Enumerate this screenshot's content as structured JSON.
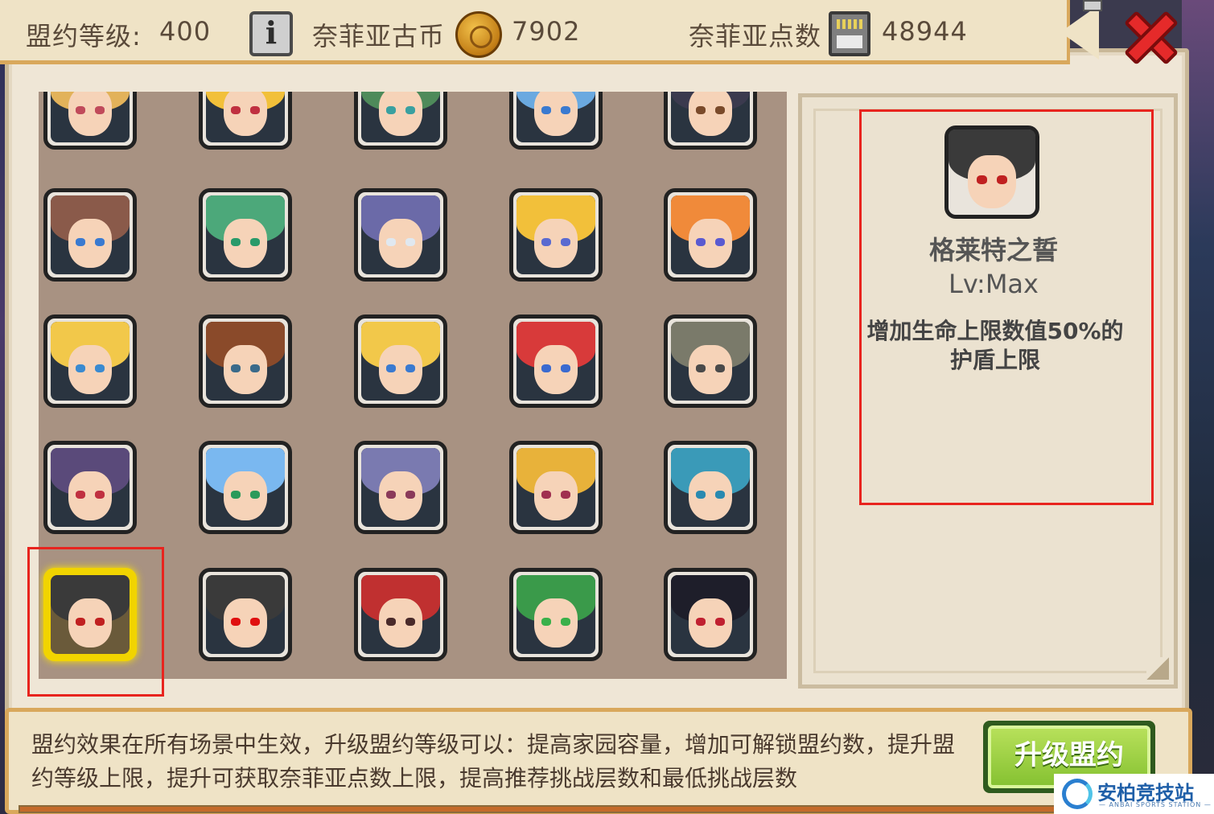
{
  "header": {
    "alliance_level_label": "盟约等级:",
    "alliance_level_value": "400",
    "coin_label": "奈菲亚古币",
    "coin_value": "7902",
    "points_label": "奈菲亚点数",
    "points_value": "48944"
  },
  "icons": {
    "info": "info-icon",
    "coin": "coin-icon",
    "points": "chip-icon",
    "close": "close-icon"
  },
  "info_glyph": "i",
  "portraits": [
    {
      "hair": "#e2b25a",
      "eye": "#c04a5a"
    },
    {
      "hair": "#f2c03a",
      "eye": "#c03040"
    },
    {
      "hair": "#4e8a5a",
      "eye": "#3aa0a0"
    },
    {
      "hair": "#6aa9e0",
      "eye": "#3a7ad0"
    },
    {
      "hair": "#3b3a4e",
      "eye": "#7a4a2a"
    },
    {
      "hair": "#8a5a4a",
      "eye": "#3a7ad0"
    },
    {
      "hair": "#4ca87a",
      "eye": "#2a9a6a"
    },
    {
      "hair": "#6b6aa8",
      "eye": "#e0e8f0"
    },
    {
      "hair": "#f2c03a",
      "eye": "#5a6ad0"
    },
    {
      "hair": "#f08a3a",
      "eye": "#5a5ad0"
    },
    {
      "hair": "#f2c84a",
      "eye": "#3a8ad0"
    },
    {
      "hair": "#8a4a2a",
      "eye": "#3a6a8a"
    },
    {
      "hair": "#f2c84a",
      "eye": "#3a7ad0"
    },
    {
      "hair": "#d83a3a",
      "eye": "#3a6ad0"
    },
    {
      "hair": "#7a7a6a",
      "eye": "#4a4a4a"
    },
    {
      "hair": "#5a4a7a",
      "eye": "#c03040"
    },
    {
      "hair": "#7ab8f0",
      "eye": "#2a9a5a"
    },
    {
      "hair": "#7a7ab0",
      "eye": "#8a3a5a"
    },
    {
      "hair": "#e8b23a",
      "eye": "#a03050"
    },
    {
      "hair": "#3a9ab8",
      "eye": "#2a8ab0"
    },
    {
      "hair": "#3a3a3a",
      "eye": "#c02020"
    },
    {
      "hair": "#3a3a3a",
      "eye": "#e01010"
    },
    {
      "hair": "#c03030",
      "eye": "#4a2a2a"
    },
    {
      "hair": "#3a9a4a",
      "eye": "#3ab04a"
    },
    {
      "hair": "#1e1e2a",
      "eye": "#c02030"
    }
  ],
  "selected_index": 20,
  "detail": {
    "name": "格莱特之誓",
    "level": "Lv:Max",
    "description": "增加生命上限数值50%的护盾上限"
  },
  "footer": {
    "description": "盟约效果在所有场景中生效，升级盟约等级可以：提高家园容量，增加可解锁盟约数，提升盟约等级上限，提升可获取奈菲亚点数上限，提高推荐挑战层数和最低挑战层数",
    "upgrade_button": "升级盟约",
    "progress_percent": 100
  },
  "watermark": {
    "title": "安柏竞技站",
    "subtitle": "— ANBAI SPORTS STATION —"
  },
  "colors": {
    "accent_red": "#e8241e",
    "selected_gold": "#f1d400",
    "button_green": "#86c232",
    "panel_bg": "#efe6d6",
    "grid_bg": "#a89282"
  }
}
